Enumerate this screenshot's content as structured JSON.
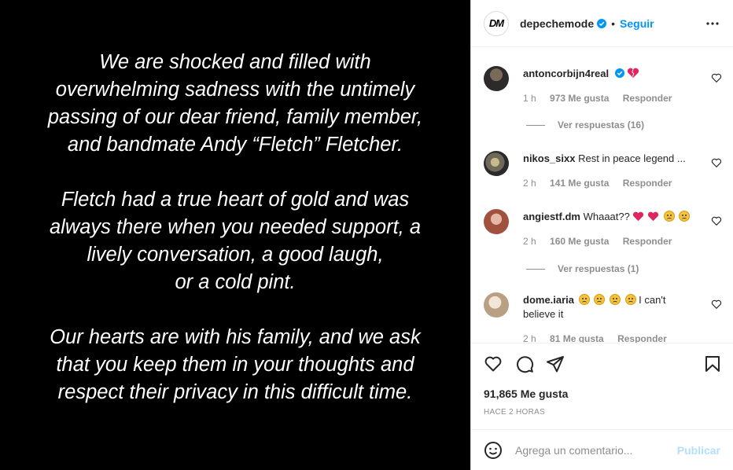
{
  "post_image": {
    "paragraphs": [
      [
        "We are shocked and filled with",
        "overwhelming sadness with the untimely",
        "passing of our dear friend, family member,",
        "and bandmate Andy “Fletch” Fletcher."
      ],
      [
        "Fletch had a true heart of gold and was",
        "always there when you needed support, a",
        "lively conversation, a good laugh,",
        "or a cold pint."
      ],
      [
        "Our hearts are with his family, and we ask",
        "that you keep them in your thoughts and",
        "respect their privacy in this difficult time."
      ]
    ]
  },
  "header": {
    "logo_text": "DM",
    "username": "depechemode",
    "separator": "•",
    "follow_label": "Seguir",
    "more_icon": "more-horizontal-icon"
  },
  "comments": [
    {
      "username": "antoncorbijn4real",
      "text": "",
      "verified": true,
      "emojis": [
        "broken-heart"
      ],
      "time": "1 h",
      "likes": "973 Me gusta",
      "reply": "Responder",
      "view_replies": "Ver respuestas (16)"
    },
    {
      "username": "nikos_sixx",
      "text": "Rest in peace legend ...",
      "time": "2 h",
      "likes": "141 Me gusta",
      "reply": "Responder"
    },
    {
      "username": "angiestf.dm",
      "text": "Whaaat??",
      "emojis": [
        "heart",
        "heart",
        "sad",
        "sad"
      ],
      "time": "2 h",
      "likes": "160 Me gusta",
      "reply": "Responder",
      "view_replies": "Ver respuestas (1)"
    },
    {
      "username": "dome.iaria",
      "text": "I can't believe it",
      "emojis": [
        "sad",
        "sad",
        "sad",
        "sad"
      ],
      "time": "2 h",
      "likes": "81 Me gusta",
      "reply": "Responder"
    }
  ],
  "actions": {
    "like_icon": "heart-icon",
    "comment_icon": "comment-icon",
    "share_icon": "send-icon",
    "save_icon": "bookmark-icon",
    "likes_count": "91,865 Me gusta",
    "posted_ago": "HACE 2 HORAS"
  },
  "add_comment": {
    "emoji_icon": "smiley-icon",
    "placeholder": "Agrega un comentario...",
    "publish_label": "Publicar"
  },
  "colors": {
    "link_blue": "#0095f6",
    "publish_disabled": "#b2dffc",
    "heart_red": "#ed4956",
    "meta_gray": "#8e8e8e"
  }
}
